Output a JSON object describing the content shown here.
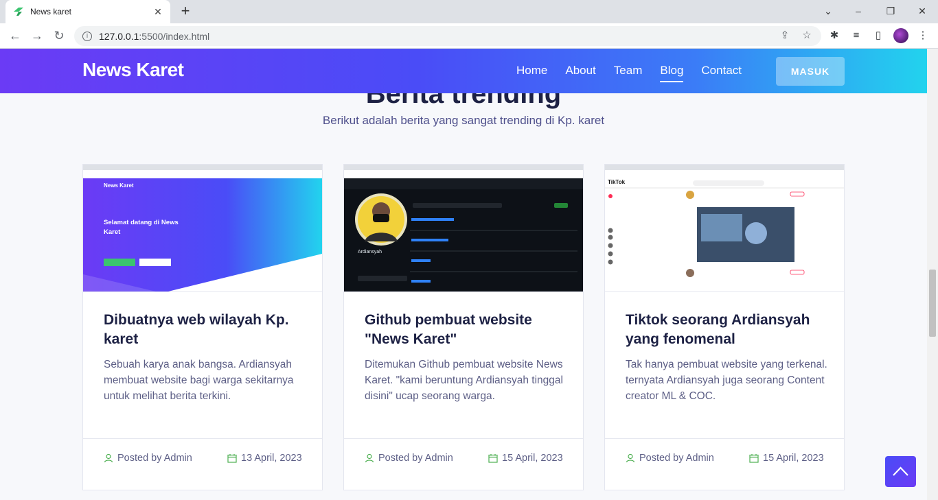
{
  "browser": {
    "tab_title": "News karet",
    "url_host": "127.0.0.1",
    "url_rest": ":5500/index.html"
  },
  "site": {
    "logo": "News Karet",
    "nav": [
      "Home",
      "About",
      "Team",
      "Blog",
      "Contact"
    ],
    "nav_active": "Blog",
    "login_button": "MASUK"
  },
  "section": {
    "title": "Berita trending",
    "subtitle": "Berikut adalah berita yang sangat trending di Kp. karet"
  },
  "cards": [
    {
      "title": "Dibuatnya web wilayah Kp. karet",
      "description": "Sebuah karya anak bangsa. Ardiansyah membuat website bagi warga sekitarnya untuk melihat berita terkini.",
      "author": "Posted by Admin",
      "date": "13 April, 2023",
      "thumb_text": "Selamat datang di News Karet"
    },
    {
      "title": "Github pembuat website \"News Karet\"",
      "description": "Ditemukan Github pembuat website News Karet. \"kami beruntung Ardiansyah tinggal disini\" ucap seorang warga.",
      "author": "Posted by Admin",
      "date": "15 April, 2023",
      "thumb_text": "Ardiansyah"
    },
    {
      "title": "Tiktok seorang Ardiansyah yang fenomenal",
      "description": "Tak hanya pembuat website yang terkenal. ternyata Ardiansyah juga seorang Content creator ML & COC.",
      "author": "Posted by Admin",
      "date": "15 April, 2023",
      "thumb_text": "TikTok"
    }
  ],
  "colors": {
    "brand": "#4a4cf7",
    "heading": "#1d2144",
    "body_text": "#5d5f86",
    "icon_green": "#4caf50"
  }
}
